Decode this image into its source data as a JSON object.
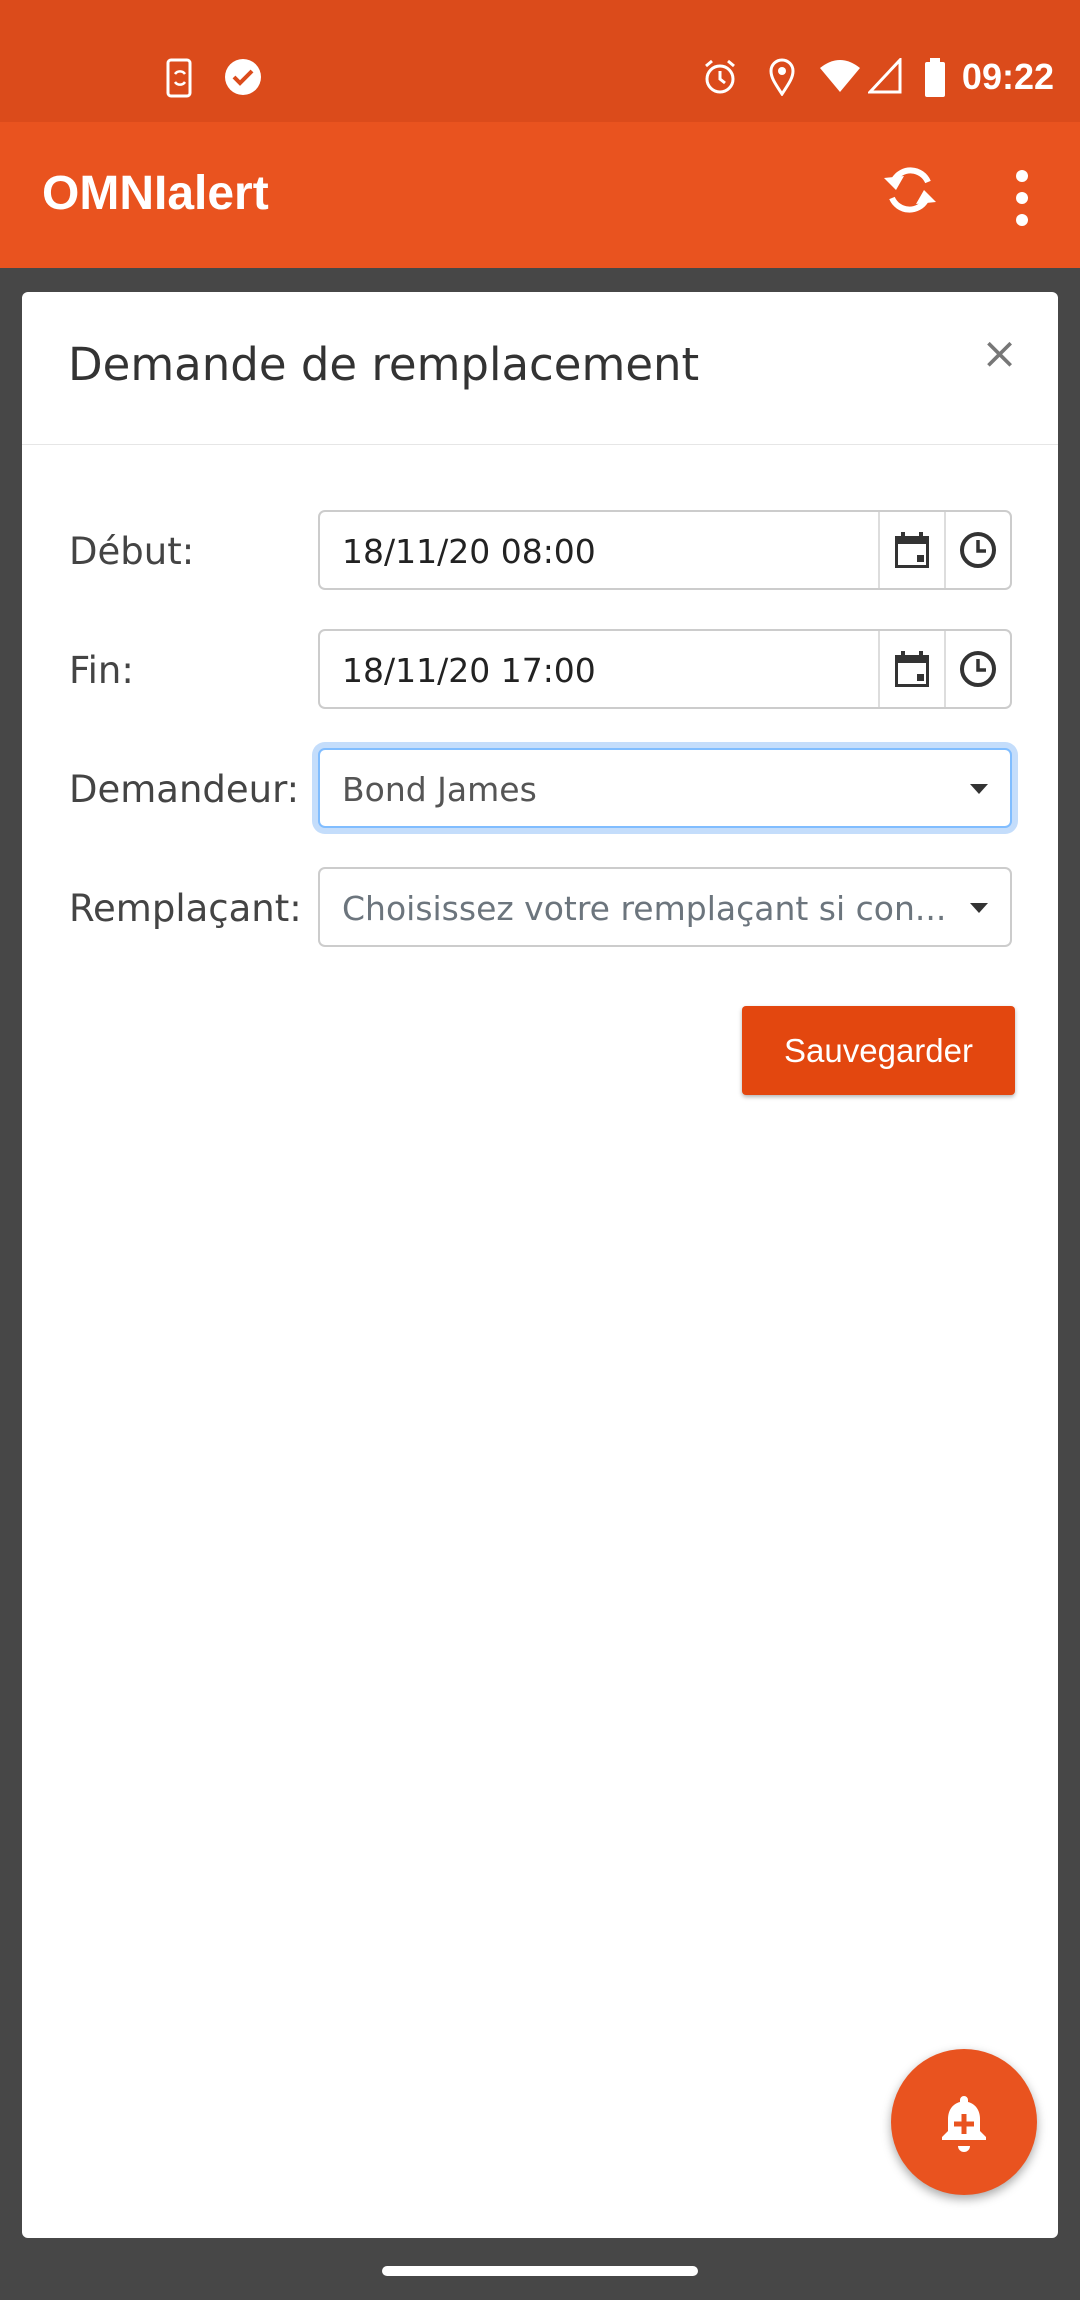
{
  "status_bar": {
    "time": "09:22",
    "icons": [
      "phone-sync-icon",
      "check-circle-icon",
      "alarm-icon",
      "location-icon",
      "wifi-icon",
      "signal-icon",
      "battery-icon"
    ]
  },
  "app_bar": {
    "title": "OMNIalert",
    "actions": [
      "sync-icon",
      "more-vert-icon"
    ]
  },
  "dialog": {
    "title": "Demande de remplacement",
    "close": "×",
    "fields": {
      "debut": {
        "label": "Début:",
        "value": "18/11/20 08:00"
      },
      "fin": {
        "label": "Fin:",
        "value": "18/11/20 17:00"
      },
      "demandeur": {
        "label": "Demandeur:",
        "value": "Bond James"
      },
      "remplacant": {
        "label": "Remplaçant:",
        "placeholder": "Choisissez votre remplaçant si con..."
      }
    },
    "save_label": "Sauvegarder"
  },
  "colors": {
    "primary": "#e9531f",
    "status_bar": "#db4b1b",
    "button": "#e3470f",
    "focus": "#80bdff"
  }
}
